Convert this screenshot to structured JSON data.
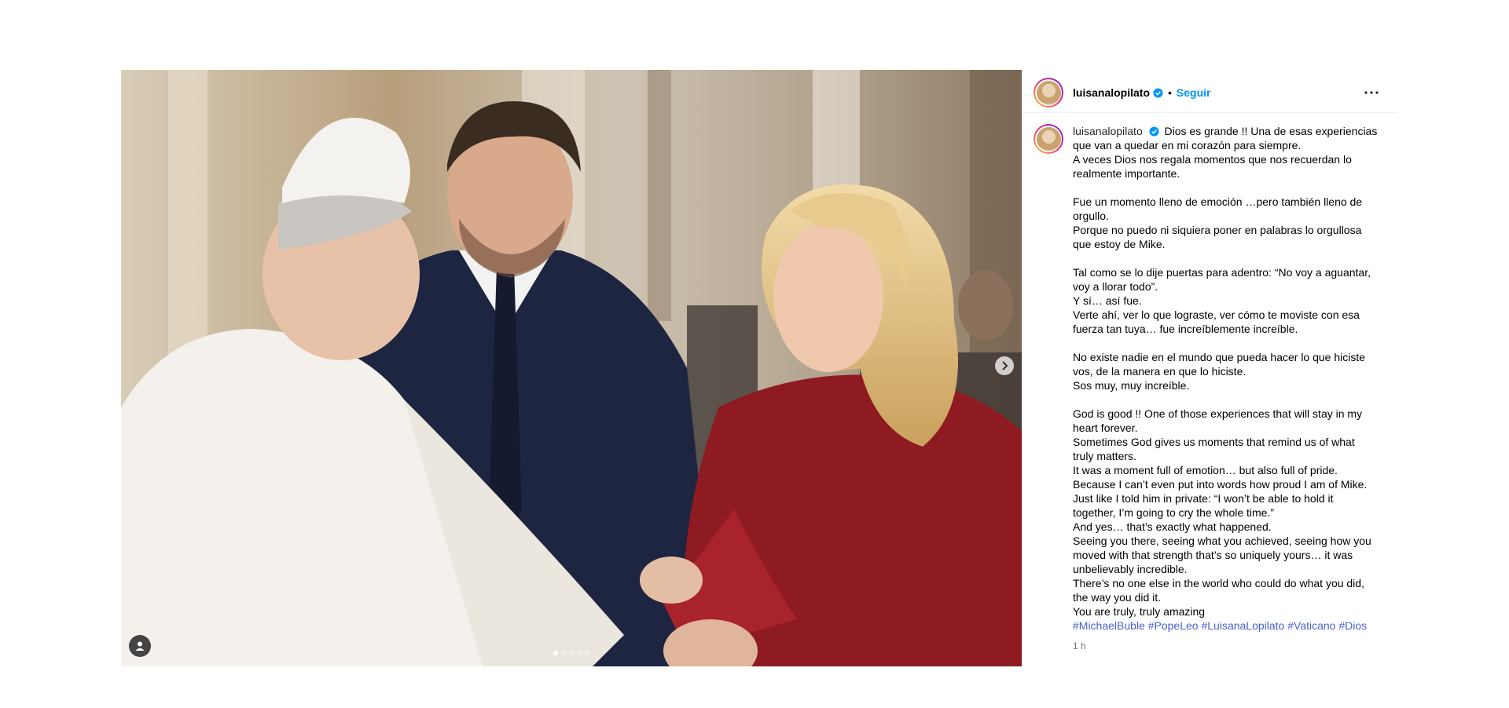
{
  "post": {
    "username": "luisanalopilato",
    "follow_label": "Seguir",
    "separator": "•",
    "carousel": {
      "slide_count": 5,
      "active_slide": 0
    }
  },
  "caption": {
    "username": "luisanalopilato",
    "lines": [
      "Dios es grande !! Una de esas experiencias",
      "que van a quedar en mi corazón para siempre.",
      "A veces Dios nos regala momentos que nos recuerdan lo",
      "realmente importante.",
      "",
      "Fue un momento lleno de emoción …pero también lleno de",
      "orgullo.",
      "Porque no puedo ni siquiera poner en palabras lo orgullosa",
      "que estoy de Mike.",
      "",
      "Tal como se lo dije puertas para adentro: “No voy a aguantar,",
      "voy a llorar todo”.",
      "Y sí… así fue.",
      "Verte ahí, ver lo que lograste, ver cómo te moviste con esa",
      "fuerza tan tuya… fue increíblemente increíble.",
      "",
      "No existe nadie en el mundo que pueda hacer lo que hiciste",
      "vos, de la manera en que lo hiciste.",
      "Sos muy, muy increíble.",
      "",
      "God is good !! One of those experiences that will stay in my",
      "heart forever.",
      "Sometimes God gives us moments that remind us of what",
      "truly matters.",
      "It was a moment full of emotion… but also full of pride.",
      "Because I can’t even put into words how proud I am of Mike.",
      "Just like I told him in private: “I won’t be able to hold it",
      "together, I’m going to cry the whole time.”",
      "And yes… that’s exactly what happened.",
      "Seeing you there, seeing what you achieved, seeing how you",
      "moved with that strength that’s so uniquely yours… it was",
      "unbelievably incredible.",
      "There’s no one else in the world who could do what you did,",
      "the way you did it.",
      "You are truly, truly amazing"
    ],
    "hashtags": [
      "#MichaelBuble",
      "#PopeLeo",
      "#LuisanaLopilato",
      "#Vaticano",
      "#Dios"
    ],
    "timestamp": "1 h"
  },
  "icons": {
    "verified": "verified-badge-icon",
    "more": "more-options-icon",
    "next": "chevron-right-icon",
    "tag": "user-tag-icon"
  },
  "colors": {
    "link_blue": "#0095f6",
    "hashtag_blue": "#4a5fd1",
    "muted": "#737373",
    "avatar_ring": "#ee2a7b"
  }
}
